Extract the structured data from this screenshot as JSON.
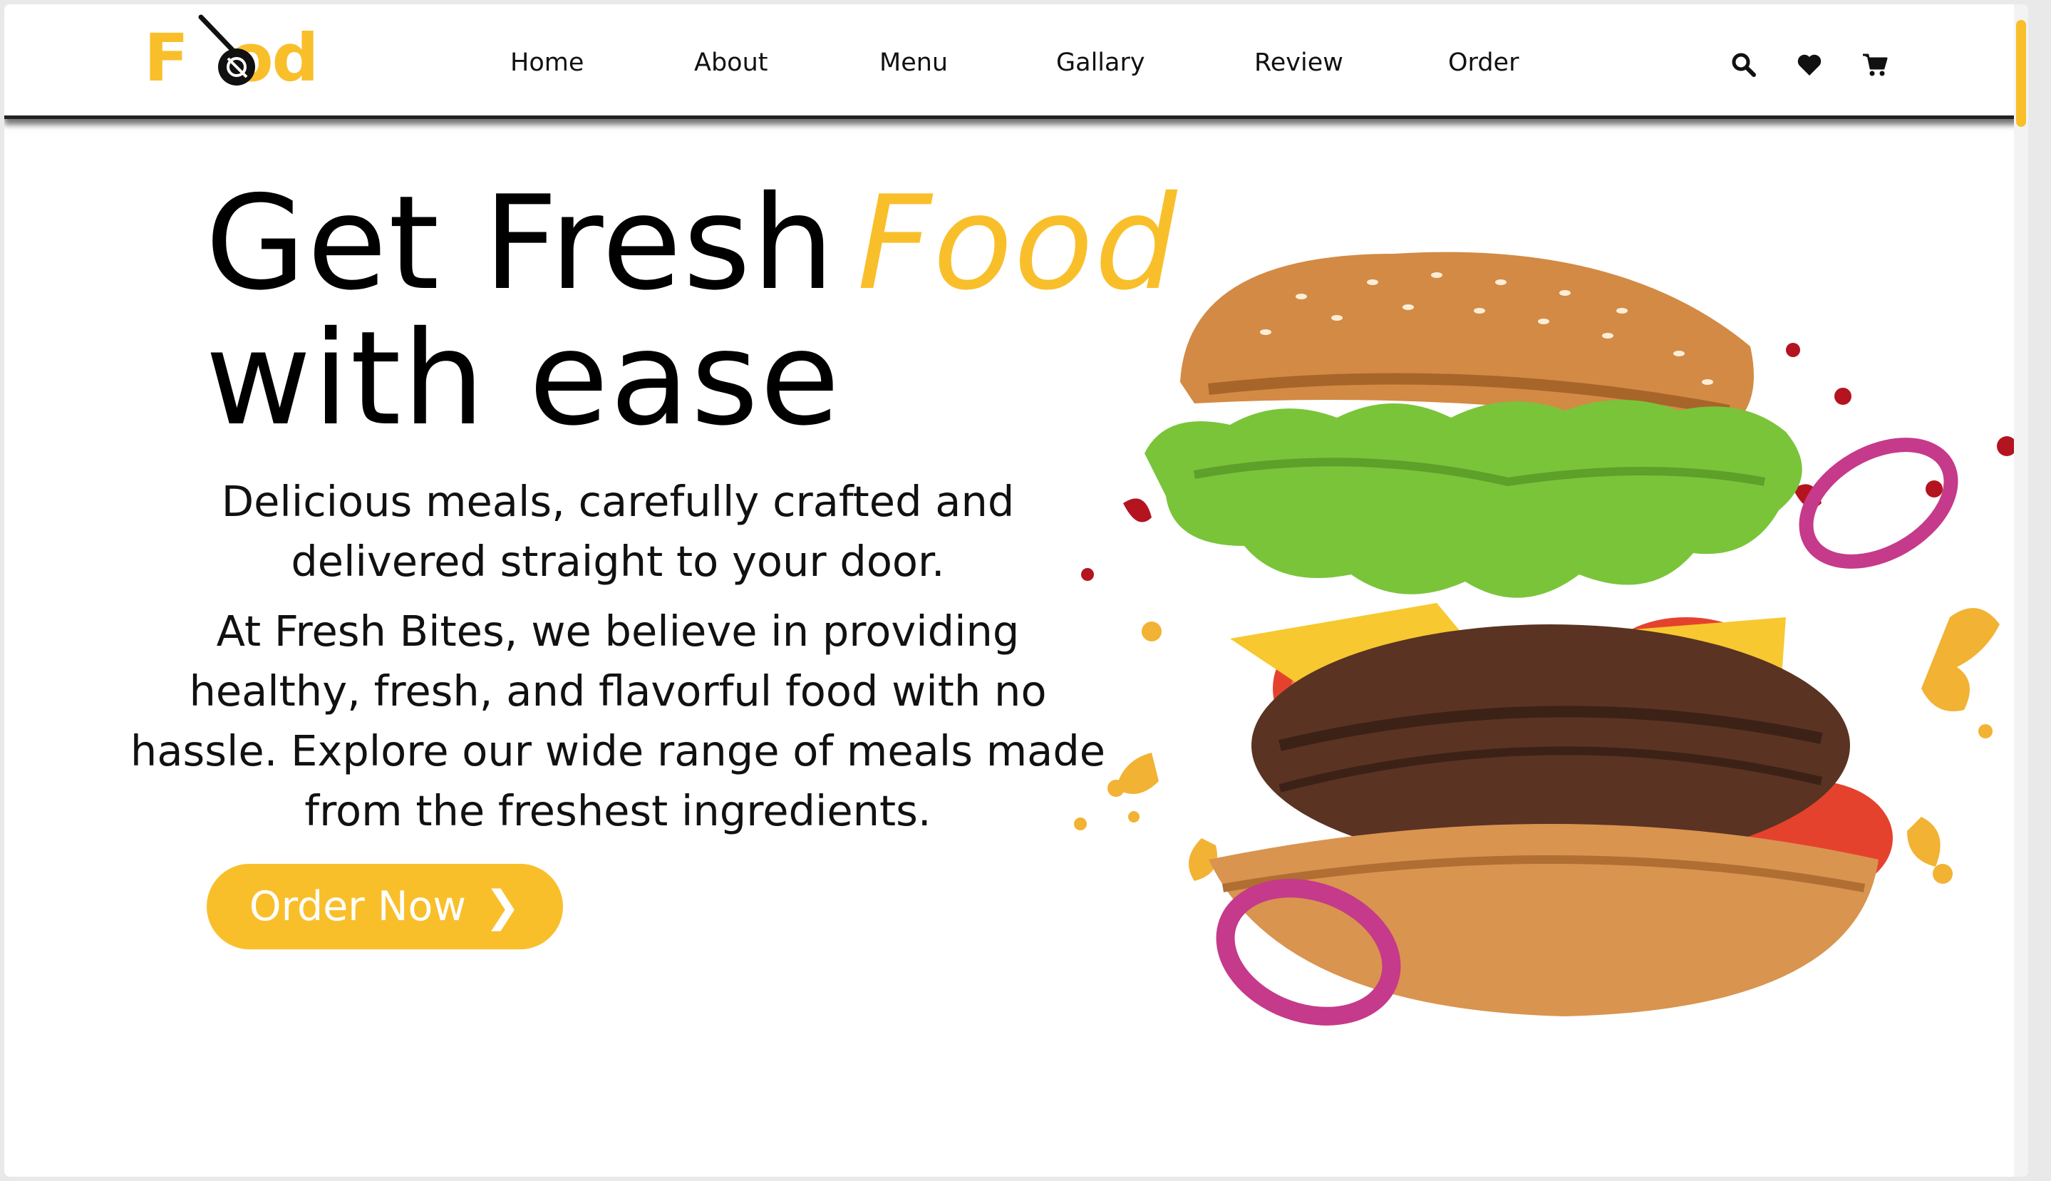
{
  "brand": {
    "logo_text": "Food",
    "accent_color": "#f9bf2b"
  },
  "nav": {
    "links": [
      "Home",
      "About",
      "Menu",
      "Gallary",
      "Review",
      "Order"
    ],
    "icons": [
      "search-icon",
      "heart-icon",
      "cart-icon"
    ]
  },
  "hero": {
    "title_line1": "Get Fresh",
    "title_accent": "Food",
    "title_line2": "with ease",
    "desc1": "Delicious meals, carefully crafted and delivered straight to your door.",
    "desc2": "At Fresh Bites, we believe in providing healthy, fresh, and flavorful food with no hassle. Explore our wide range of meals made from the freshest ingredients.",
    "cta_label": "Order Now",
    "cta_icon": "chevron-right-icon",
    "image": "burger-image"
  }
}
